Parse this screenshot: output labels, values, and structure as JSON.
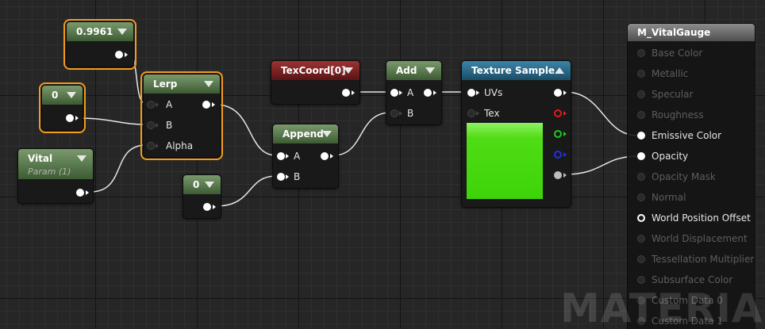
{
  "nodes": {
    "const_top": {
      "value": "0.9961"
    },
    "const_mid": {
      "value": "0"
    },
    "vital": {
      "title": "Vital",
      "subtitle": "Param (1)"
    },
    "lerp": {
      "title": "Lerp",
      "inputs": [
        "A",
        "B",
        "Alpha"
      ]
    },
    "const_bottom": {
      "value": "0"
    },
    "append": {
      "title": "Append",
      "inputs": [
        "A",
        "B"
      ]
    },
    "texcoord": {
      "title": "TexCoord[0]"
    },
    "add": {
      "title": "Add",
      "inputs": [
        "A",
        "B"
      ]
    },
    "texture_sample": {
      "title": "Texture Sample",
      "inputs": [
        "UVs",
        "Tex"
      ]
    }
  },
  "result_node": {
    "title": "M_VitalGauge",
    "inputs": [
      {
        "label": "Base Color",
        "state": "inactive"
      },
      {
        "label": "Metallic",
        "state": "inactive"
      },
      {
        "label": "Specular",
        "state": "inactive"
      },
      {
        "label": "Roughness",
        "state": "inactive"
      },
      {
        "label": "Emissive Color",
        "state": "connected"
      },
      {
        "label": "Opacity",
        "state": "connected"
      },
      {
        "label": "Opacity Mask",
        "state": "inactive"
      },
      {
        "label": "Normal",
        "state": "inactive"
      },
      {
        "label": "World Position Offset",
        "state": "active"
      },
      {
        "label": "World Displacement",
        "state": "inactive"
      },
      {
        "label": "Tessellation Multiplier",
        "state": "inactive"
      },
      {
        "label": "Subsurface Color",
        "state": "inactive"
      },
      {
        "label": "Custom Data 0",
        "state": "inactive"
      },
      {
        "label": "Custom Data 1",
        "state": "inactive"
      }
    ]
  },
  "watermark": "MATERIAL",
  "colors": {
    "selection": "#f39a1e",
    "param_header": "#4e6b42",
    "texcoord_header": "#7a2424",
    "texture_header": "#2b6a8a",
    "swatch": "#3ed409"
  }
}
